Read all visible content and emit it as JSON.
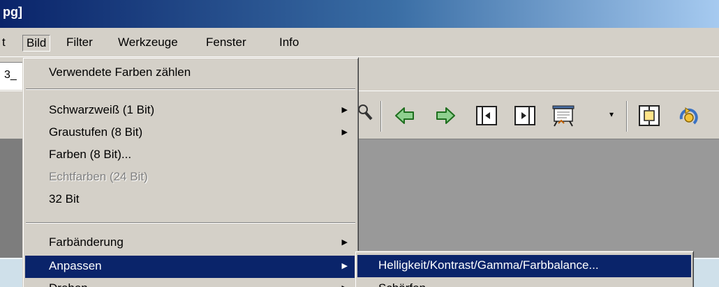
{
  "window": {
    "title": "pg]"
  },
  "menubar": {
    "items": [
      {
        "label": "t"
      },
      {
        "label": "Bild"
      },
      {
        "label": "Filter"
      },
      {
        "label": "Werkzeuge"
      },
      {
        "label": "Fenster"
      },
      {
        "label": "Info"
      }
    ],
    "active": "Bild"
  },
  "tabs": {
    "current_label": "3_"
  },
  "toolbar": {
    "icons": [
      "magnifier-icon",
      "arrow-left-icon",
      "arrow-right-icon",
      "page-previous-icon",
      "page-next-icon",
      "slideshow-icon",
      "fit-window-icon",
      "rotate-icon"
    ],
    "dropdown_symbol": "▾"
  },
  "bild_menu": {
    "items": [
      {
        "label": "Verwendete Farben zählen",
        "submenu": false,
        "disabled": false
      },
      {
        "label": "Schwarzweiß (1 Bit)",
        "submenu": true,
        "disabled": false
      },
      {
        "label": "Graustufen (8 Bit)",
        "submenu": true,
        "disabled": false
      },
      {
        "label": "Farben (8 Bit)...",
        "submenu": false,
        "disabled": false
      },
      {
        "label": "Echtfarben (24 Bit)",
        "submenu": false,
        "disabled": true
      },
      {
        "label": "32 Bit",
        "submenu": false,
        "disabled": false
      },
      {
        "label": "Farbänderung",
        "submenu": true,
        "disabled": false
      },
      {
        "label": "Anpassen",
        "submenu": true,
        "disabled": false,
        "highlighted": true
      },
      {
        "label": "Drehen",
        "submenu": true,
        "disabled": false
      }
    ],
    "submenu_arrow": "▶"
  },
  "anpassen_submenu": {
    "items": [
      {
        "label": "Helligkeit/Kontrast/Gamma/Farbbalance...",
        "highlighted": true
      },
      {
        "label": "Schärfen"
      }
    ]
  },
  "colors": {
    "menu_highlight": "#0a246a",
    "face": "#d4d0c8",
    "arrow_green": "#2f9e2f"
  }
}
